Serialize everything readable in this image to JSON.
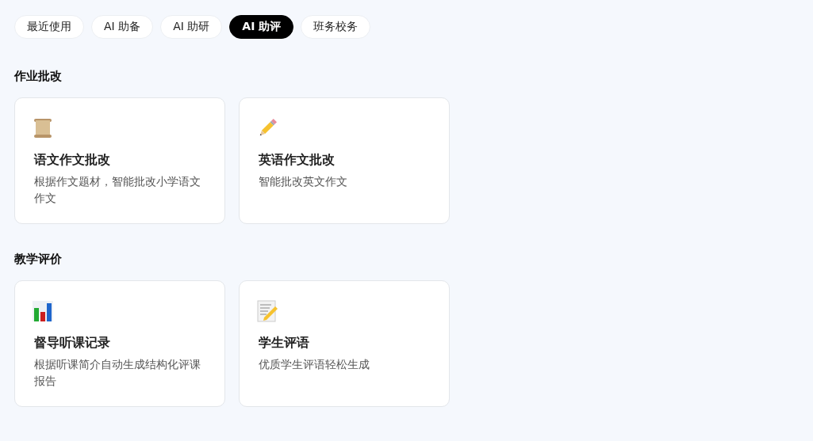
{
  "tabs": [
    {
      "label": "最近使用",
      "selected": false
    },
    {
      "label": "AI 助备",
      "selected": false
    },
    {
      "label": "AI 助研",
      "selected": false
    },
    {
      "label": "AI 助评",
      "selected": true
    },
    {
      "label": "班务校务",
      "selected": false
    }
  ],
  "sections": [
    {
      "title": "作业批改",
      "cards": [
        {
          "title": "语文作文批改",
          "description": "根据作文题材，智能批改小学语文作文"
        },
        {
          "title": "英语作文批改",
          "description": "智能批改英文作文"
        }
      ]
    },
    {
      "title": "教学评价",
      "cards": [
        {
          "title": "督导听课记录",
          "description": "根据听课简介自动生成结构化评课报告"
        },
        {
          "title": "学生评语",
          "description": "优质学生评语轻松生成"
        }
      ]
    }
  ]
}
